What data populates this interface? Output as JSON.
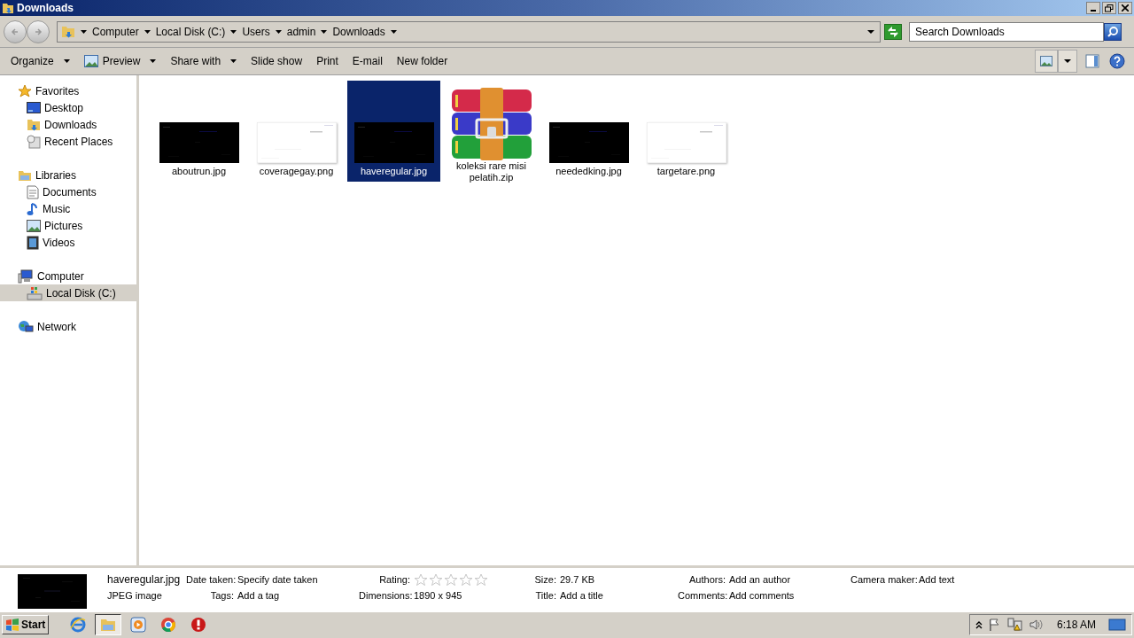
{
  "window": {
    "title": "Downloads"
  },
  "address": {
    "crumbs": [
      "Computer",
      "Local Disk (C:)",
      "Users",
      "admin",
      "Downloads"
    ],
    "search_placeholder": "Search Downloads"
  },
  "toolbar": [
    {
      "label": "Organize",
      "dropdown": true
    },
    {
      "label": "Preview",
      "dropdown": true
    },
    {
      "label": "Share with",
      "dropdown": true
    },
    {
      "label": "Slide show",
      "dropdown": false
    },
    {
      "label": "Print",
      "dropdown": false
    },
    {
      "label": "E-mail",
      "dropdown": false
    },
    {
      "label": "New folder",
      "dropdown": false
    }
  ],
  "sidebar": [
    {
      "label": "Favorites",
      "selected": false,
      "children": [
        {
          "label": "Desktop",
          "selected": false
        },
        {
          "label": "Downloads",
          "selected": false
        },
        {
          "label": "Recent Places",
          "selected": false
        }
      ]
    },
    {
      "label": "Libraries",
      "selected": false,
      "children": [
        {
          "label": "Documents",
          "selected": false
        },
        {
          "label": "Music",
          "selected": false
        },
        {
          "label": "Pictures",
          "selected": false
        },
        {
          "label": "Videos",
          "selected": false
        }
      ]
    },
    {
      "label": "Computer",
      "selected": false,
      "children": [
        {
          "label": "Local Disk (C:)",
          "selected": true
        }
      ]
    },
    {
      "label": "Network",
      "selected": false
    }
  ],
  "files": [
    {
      "name": "aboutrun.jpg",
      "kind": "dark",
      "selected": false
    },
    {
      "name": "coveragegay.png",
      "kind": "light",
      "selected": false
    },
    {
      "name": "haveregular.jpg",
      "kind": "dark",
      "selected": true
    },
    {
      "name": "koleksi rare misi pelatih.zip",
      "kind": "archive",
      "selected": false
    },
    {
      "name": "neededking.jpg",
      "kind": "dark",
      "selected": false
    },
    {
      "name": "targetare.png",
      "kind": "light",
      "selected": false
    }
  ],
  "details": {
    "name": "haveregular.jpg",
    "type": "JPEG image",
    "columns": [
      [
        {
          "label": "Date taken:",
          "value": "Specify date taken"
        },
        {
          "label": "Tags:",
          "value": "Add a tag"
        }
      ],
      [
        {
          "label": "Rating:",
          "kind": "rating",
          "stars": 0
        },
        {
          "label": "Dimensions:",
          "value": "1890 x 945"
        }
      ],
      [
        {
          "label": "Size:",
          "value": "29.7 KB"
        },
        {
          "label": "Title:",
          "value": "Add a title"
        }
      ],
      [
        {
          "label": "Authors:",
          "value": "Add an author"
        },
        {
          "label": "Comments:",
          "value": "Add comments"
        }
      ],
      [
        {
          "label": "Camera maker:",
          "value": "Add text"
        }
      ]
    ]
  },
  "taskbar": {
    "start": "Start",
    "clock": "6:18 AM",
    "apps": [
      {
        "selected": false
      },
      {
        "selected": true
      },
      {
        "selected": false
      },
      {
        "selected": false
      },
      {
        "selected": false
      }
    ]
  }
}
